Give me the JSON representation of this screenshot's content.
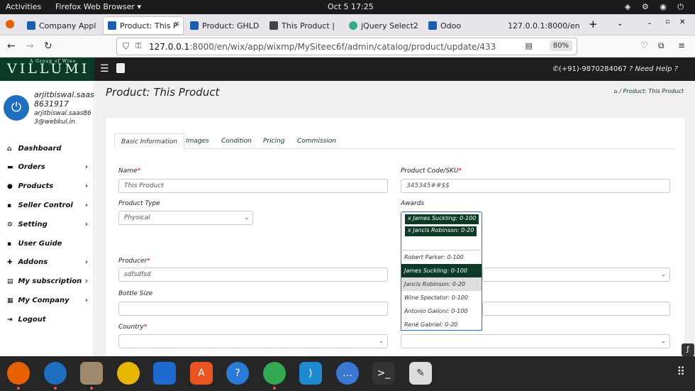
{
  "os": {
    "activities": "Activities",
    "app": "Firefox Web Browser ▾",
    "clock": "Oct 5  17:25"
  },
  "browser": {
    "tabs": [
      {
        "label": "Company Appl",
        "color": "#1a5fb4"
      },
      {
        "label": "Product: This P",
        "color": "#1a5fb4"
      },
      {
        "label": "Product: GHLD",
        "color": "#1a5fb4"
      },
      {
        "label": "This Product |",
        "color": "#444"
      },
      {
        "label": "jQuery Select2",
        "color": "#3a8"
      },
      {
        "label": "Odoo",
        "color": "#1a5fb4"
      },
      {
        "label": "127.0.0.1:8000/en",
        "color": "#ddd"
      }
    ],
    "url_host": "127.0.0.1",
    "url_rest": ":8000/en/wix/app/wixmp/MySiteec6f/admin/catalog/product/update/433",
    "zoom": "80%"
  },
  "header": {
    "logo": "VILLUMI",
    "logo_sub": "A Group of Wine",
    "phone": "(+91)-9870284067",
    "help": "Need Help ?"
  },
  "user": {
    "name": "arjitbiswal.saas 8631917",
    "email": "arjitbiswal.saas86 3@webkul.in"
  },
  "sidebar": [
    {
      "label": "Dashboard",
      "icon": "home"
    },
    {
      "label": "Orders",
      "icon": "cart"
    },
    {
      "label": "Products",
      "icon": "product"
    },
    {
      "label": "Seller Control",
      "icon": "seller"
    },
    {
      "label": "Setting",
      "icon": "gear"
    },
    {
      "label": "User Guide",
      "icon": "guide"
    },
    {
      "label": "Addons",
      "icon": "addons"
    },
    {
      "label": "My subscription",
      "icon": "subscription"
    },
    {
      "label": "My Company",
      "icon": "company"
    },
    {
      "label": "Logout",
      "icon": "logout"
    }
  ],
  "page": {
    "title": "Product: This Product",
    "breadcrumb": "/  Product: This Product"
  },
  "tabs": [
    "Basic Information",
    "Images",
    "Condition",
    "Pricing",
    "Commission"
  ],
  "form": {
    "name_label": "Name",
    "name_value": "This Product",
    "sku_label": "Product Code/SKU",
    "sku_value": "345345##$$",
    "type_label": "Product Type",
    "type_value": "Physical",
    "awards_label": "Awards",
    "awards_selected": [
      "James Suckling: 0-100",
      "Jancis Robinson: 0-20"
    ],
    "awards_options": [
      "Robert Parker: 0-100",
      "James Suckling: 0-100",
      "Jancis Robinson: 0-20",
      "Wine Spectator: 0-100",
      "Antonio Galloni: 0-100",
      "René Gabriel: 0-20"
    ],
    "producer_label": "Producer",
    "producer_value": "sdfsdfsd",
    "bottle_label": "Bottle Size",
    "country_label": "Country"
  },
  "dock": [
    {
      "name": "firefox",
      "color": "#e66000"
    },
    {
      "name": "thunderbird",
      "color": "#1f6fc1"
    },
    {
      "name": "files",
      "color": "#9e8a6a"
    },
    {
      "name": "rhythmbox",
      "color": "#e8b500"
    },
    {
      "name": "writer",
      "color": "#1e6bd0"
    },
    {
      "name": "software",
      "color": "#e95420"
    },
    {
      "name": "help",
      "color": "#2a7ad8"
    },
    {
      "name": "chrome",
      "color": "#34a853"
    },
    {
      "name": "vscode",
      "color": "#1f8ad2"
    },
    {
      "name": "chat",
      "color": "#3a78d4"
    },
    {
      "name": "terminal",
      "color": "#333"
    },
    {
      "name": "editor",
      "color": "#ddd"
    }
  ]
}
